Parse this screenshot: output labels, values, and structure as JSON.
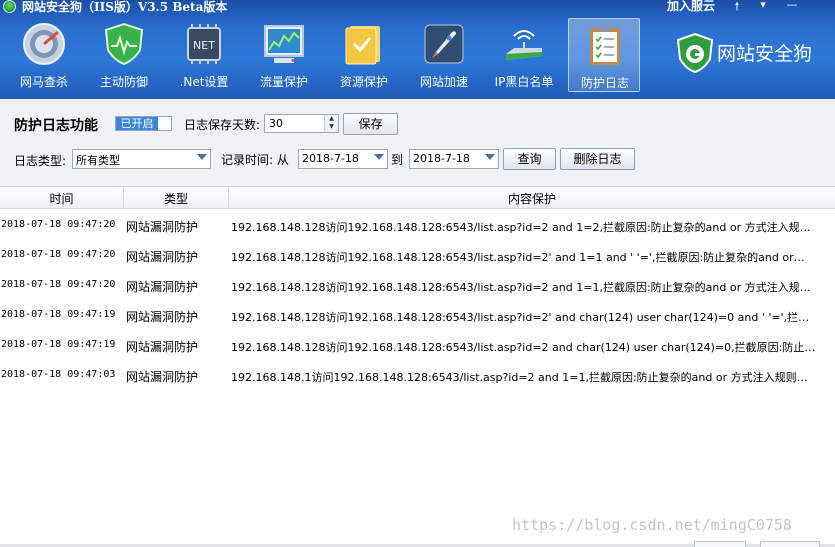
{
  "app": {
    "title": "网站安全狗（IIS版）V3.5 Beta版本",
    "join_cloud": "加入服云",
    "pin_glyph": "🠕",
    "menu_glyph": "▾",
    "minimize_glyph": "—"
  },
  "toolbar": {
    "items": [
      {
        "label": "网马查杀",
        "icon": "scan-disc-icon"
      },
      {
        "label": "主动防御",
        "icon": "shield-icon"
      },
      {
        "label": ".Net设置",
        "icon": "chip-icon"
      },
      {
        "label": "流量保护",
        "icon": "monitor-chart-icon"
      },
      {
        "label": "资源保护",
        "icon": "folder-icon"
      },
      {
        "label": "网站加速",
        "icon": "rocket-icon"
      },
      {
        "label": "IP黑白名单",
        "icon": "router-icon"
      },
      {
        "label": "防护日志",
        "icon": "clipboard-icon"
      }
    ],
    "active_index": 7
  },
  "brand": {
    "text": "网站安全狗",
    "icon": "dog-badge-icon"
  },
  "settings": {
    "feature_title": "防护日志功能",
    "toggle_label": "已开启",
    "days_label": "日志保存天数:",
    "days_value": "30",
    "save_label": "保存"
  },
  "filters": {
    "type_label": "日志类型:",
    "type_value": "所有类型",
    "time_label": "记录时间: 从",
    "from_date": "2018-7-18",
    "to_label": "到",
    "to_date": "2018-7-18",
    "query_label": "查询",
    "delete_label": "删除日志"
  },
  "table": {
    "headers": [
      "时间",
      "类型",
      "内容保护"
    ],
    "rows": [
      {
        "time": "2018-07-18 09:47:20",
        "type": "网站漏洞防护",
        "content": "192.168.148.128访问192.168.148.128:6543/list.asp?id=2 and 1=2,拦截原因:防止复杂的and or 方式注入规…"
      },
      {
        "time": "2018-07-18 09:47:20",
        "type": "网站漏洞防护",
        "content": "192.168.148.128访问192.168.148.128:6543/list.asp?id=2'  and 1=1 and ' '=',拦截原因:防止复杂的and or…"
      },
      {
        "time": "2018-07-18 09:47:20",
        "type": "网站漏洞防护",
        "content": "192.168.148.128访问192.168.148.128:6543/list.asp?id=2 and 1=1,拦截原因:防止复杂的and or 方式注入规…"
      },
      {
        "time": "2018-07-18 09:47:19",
        "type": "网站漏洞防护",
        "content": "192.168.148.128访问192.168.148.128:6543/list.asp?id=2'  and char(124) user char(124)=0 and ' '=',拦…"
      },
      {
        "time": "2018-07-18 09:47:19",
        "type": "网站漏洞防护",
        "content": "192.168.148.128访问192.168.148.128:6543/list.asp?id=2 and char(124) user char(124)=0,拦截原因:防止…"
      },
      {
        "time": "2018-07-18 09:47:03",
        "type": "网站漏洞防护",
        "content": "192.168.148.1访问192.168.148.128:6543/list.asp?id=2 and 1=1,拦截原因:防止复杂的and or 方式注入规则…"
      }
    ]
  },
  "watermark": "https://blog.csdn.net/mingC0758",
  "colors": {
    "header": "#2a6fd0",
    "accent": "#3d86d6",
    "panel": "#f0f2f5"
  }
}
